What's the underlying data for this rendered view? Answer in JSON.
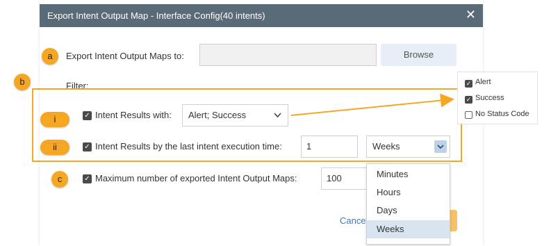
{
  "window": {
    "title": "Export Intent Output Map - Interface Config(40 intents)",
    "close_glyph": "✕"
  },
  "markers": {
    "a": "a",
    "b": "b",
    "i": "i",
    "ii": "ii",
    "c": "c"
  },
  "export": {
    "label": "Export Intent Output Maps to:",
    "path_value": "",
    "browse_label": "Browse"
  },
  "filter": {
    "label": "Filter:",
    "results_with": {
      "label": "Intent Results with:",
      "checked": true,
      "value": "Alert; Success"
    },
    "by_last_time": {
      "label": "Intent Results by the last intent execution time:",
      "checked": true,
      "number": "1",
      "unit": "Weeks"
    }
  },
  "max_export": {
    "label": "Maximum number of exported Intent Output Maps:",
    "checked": true,
    "value": "100"
  },
  "unit_options": [
    "Minutes",
    "Hours",
    "Days",
    "Weeks"
  ],
  "unit_selected_index": 3,
  "status_options": [
    {
      "label": "Alert",
      "checked": true
    },
    {
      "label": "Success",
      "checked": true
    },
    {
      "label": "No Status Code",
      "checked": false
    }
  ],
  "footer": {
    "cancel_label": "Cance"
  },
  "colors": {
    "titlebar": "#5a6b78",
    "accent": "#f5a623",
    "browse_bg": "#e7eef8",
    "selection": "#d8e4ef"
  }
}
